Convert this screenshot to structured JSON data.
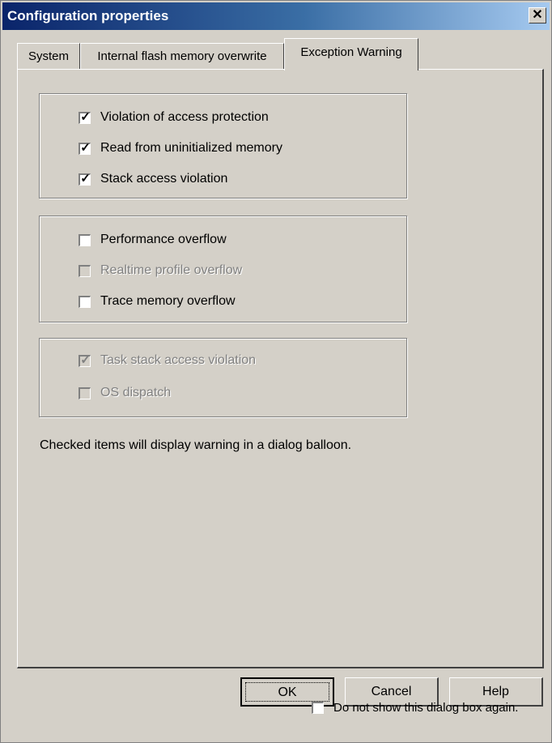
{
  "window": {
    "title": "Configuration properties",
    "close_glyph": "✕",
    "close_icon": "close-icon"
  },
  "tabs": [
    {
      "label": "System",
      "active": false
    },
    {
      "label": "Internal flash memory overwrite",
      "active": false
    },
    {
      "label": "Exception Warning",
      "active": true
    }
  ],
  "groups": [
    {
      "items": [
        {
          "label": "Violation of access protection",
          "checked": true,
          "enabled": true
        },
        {
          "label": "Read from uninitialized memory",
          "checked": true,
          "enabled": true
        },
        {
          "label": "Stack access violation",
          "checked": true,
          "enabled": true
        }
      ]
    },
    {
      "items": [
        {
          "label": "Performance overflow",
          "checked": false,
          "enabled": true
        },
        {
          "label": "Realtime profile overflow",
          "checked": false,
          "enabled": false
        },
        {
          "label": "Trace memory overflow",
          "checked": false,
          "enabled": true
        }
      ]
    },
    {
      "items": [
        {
          "label": "Task stack access violation",
          "checked": true,
          "enabled": false
        },
        {
          "label": "OS dispatch",
          "checked": false,
          "enabled": false
        }
      ]
    }
  ],
  "note": "Checked items will display warning in a dialog balloon.",
  "buttons": {
    "ok": "OK",
    "cancel": "Cancel",
    "help": "Help"
  },
  "footer": {
    "dont_show_label": "Do not show this dialog box again.",
    "dont_show_checked": false
  },
  "check_glyph": "✓"
}
